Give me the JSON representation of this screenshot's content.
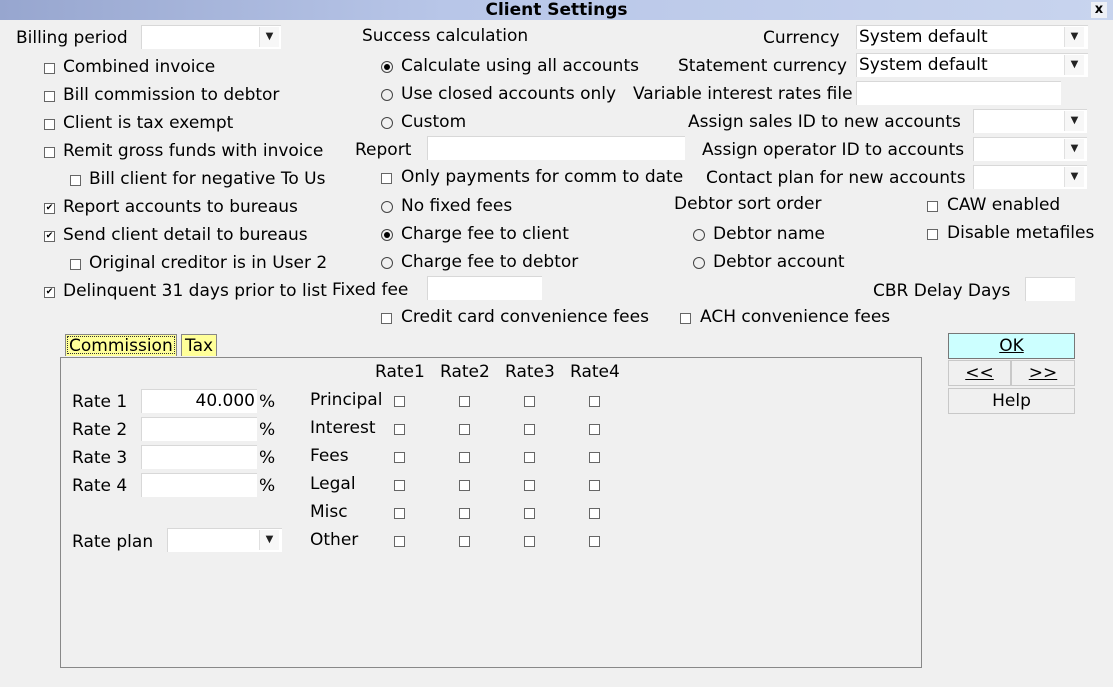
{
  "window": {
    "title": "Client Settings",
    "close_label": "x"
  },
  "left": {
    "billing_period_label": "Billing period",
    "billing_period_value": "",
    "checks": [
      {
        "label": "Combined invoice",
        "checked": false
      },
      {
        "label": "Bill commission to debtor",
        "checked": false
      },
      {
        "label": "Client is tax exempt",
        "checked": false
      },
      {
        "label": "Remit gross funds with invoice",
        "checked": false
      },
      {
        "label": "Bill client for negative To Us",
        "checked": false
      },
      {
        "label": "Report accounts to bureaus",
        "checked": true
      },
      {
        "label": "Send client detail to bureaus",
        "checked": true
      },
      {
        "label": "Original creditor is in User 2",
        "checked": false
      },
      {
        "label": "Delinquent 31 days prior to list",
        "checked": true
      }
    ]
  },
  "middle": {
    "success_calc_label": "Success calculation",
    "success_options": [
      {
        "label": "Calculate using all accounts",
        "selected": true
      },
      {
        "label": "Use closed accounts only",
        "selected": false
      },
      {
        "label": "Custom",
        "selected": false
      }
    ],
    "report_label": "Report",
    "report_value": "",
    "only_payments_label": "Only payments for comm to date",
    "only_payments_checked": false,
    "fee_options": [
      {
        "label": "No fixed fees",
        "selected": false
      },
      {
        "label": "Charge fee to client",
        "selected": true
      },
      {
        "label": "Charge fee to debtor",
        "selected": false
      }
    ],
    "fixed_fee_label": "Fixed fee",
    "fixed_fee_value": "",
    "credit_card_fees_label": "Credit card convenience fees",
    "credit_card_fees_checked": false,
    "ach_fees_label": "ACH convenience fees",
    "ach_fees_checked": false
  },
  "right": {
    "currency_label": "Currency",
    "currency_value": "System default",
    "statement_currency_label": "Statement currency",
    "statement_currency_value": "System default",
    "variable_rates_label": "Variable interest rates file",
    "variable_rates_value": "",
    "sales_id_label": "Assign sales ID to new accounts",
    "sales_id_value": "",
    "operator_id_label": "Assign operator ID to accounts",
    "operator_id_value": "",
    "contact_plan_label": "Contact plan for new accounts",
    "contact_plan_value": "",
    "debtor_sort_label": "Debtor sort order",
    "debtor_sort_options": [
      {
        "label": "Debtor name",
        "selected": false
      },
      {
        "label": "Debtor account",
        "selected": false
      }
    ],
    "caw_label": "CAW enabled",
    "caw_checked": false,
    "metafiles_label": "Disable metafiles",
    "metafiles_checked": false,
    "cbr_delay_label": "CBR Delay Days",
    "cbr_delay_value": ""
  },
  "tabs": [
    {
      "label": "Commission",
      "active": true
    },
    {
      "label": "Tax",
      "active": false
    }
  ],
  "commission": {
    "rates": [
      {
        "label": "Rate 1",
        "value": "40.000",
        "unit": "%"
      },
      {
        "label": "Rate 2",
        "value": "",
        "unit": "%"
      },
      {
        "label": "Rate 3",
        "value": "",
        "unit": "%"
      },
      {
        "label": "Rate 4",
        "value": "",
        "unit": "%"
      }
    ],
    "rate_plan_label": "Rate plan",
    "rate_plan_value": "",
    "columns": [
      "Rate1",
      "Rate2",
      "Rate3",
      "Rate4"
    ],
    "rows": [
      "Principal",
      "Interest",
      "Fees",
      "Legal",
      "Misc",
      "Other"
    ]
  },
  "buttons": {
    "ok": "OK",
    "prev": "<<",
    "next": ">>",
    "help": "Help"
  }
}
